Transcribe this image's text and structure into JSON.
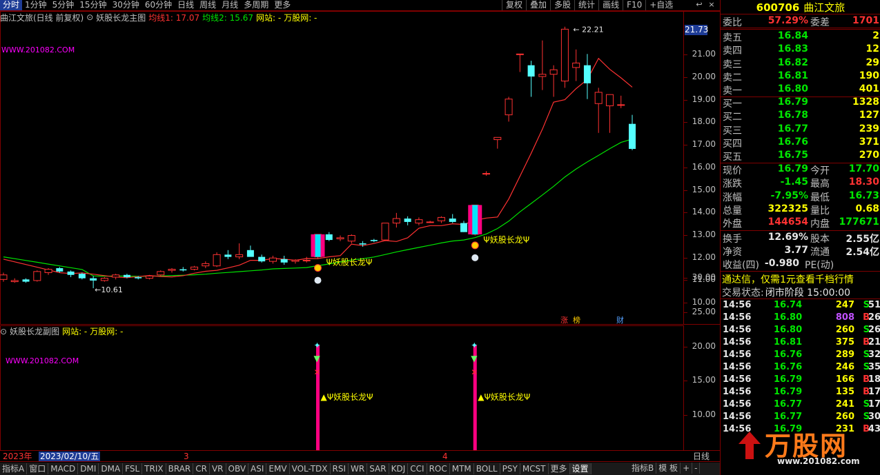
{
  "periods": [
    "分时",
    "1分钟",
    "5分钟",
    "15分钟",
    "30分钟",
    "60分钟",
    "日线",
    "周线",
    "月线",
    "多周期",
    "更多"
  ],
  "active_period": "分时",
  "tools": [
    "复权",
    "叠加",
    "多股",
    "统计",
    "画线",
    "F10",
    "+自选"
  ],
  "win": {
    "back": "↩",
    "close": "×"
  },
  "main": {
    "title": "曲江文旅(日线 前复权)",
    "indicator": "妖股长龙主图",
    "ma1_label": "均线1: 17.07",
    "ma2_label": "均线2: 15.67",
    "site_label": "网站: -",
    "wan_label": "万股网: -",
    "site_url": "WWW.201082.COM",
    "high_label": "22.21",
    "low_label": "←10.61",
    "signal_text": "Ψ妖股长龙Ψ",
    "current_price_tag": "21.73",
    "zhang_tag": "涨",
    "bang_tag": "榜",
    "cai_tag": "财"
  },
  "yaxis_main": [
    "21.00",
    "20.00",
    "19.00",
    "18.00",
    "17.00",
    "16.00",
    "15.00",
    "14.00",
    "13.00",
    "12.00",
    "11.00",
    "10.00"
  ],
  "sub": {
    "indicator": "妖股长龙副图",
    "site_label": "网站: -",
    "wan_label": "万股网: -",
    "site_url": "WWW.201082.COM",
    "signal_text": "▲Ψ妖股长龙Ψ"
  },
  "yaxis_sub": [
    "30.00",
    "25.00",
    "20.00",
    "15.00",
    "10.00"
  ],
  "datebar": {
    "year": "2023年",
    "date": "2023/02/10/五",
    "m3": "3",
    "m4": "4",
    "mode": "日线"
  },
  "tabs": [
    "指标A",
    "窗口",
    "MACD",
    "DMI",
    "DMA",
    "FSL",
    "TRIX",
    "BRAR",
    "CR",
    "VR",
    "OBV",
    "ASI",
    "EMV",
    "VOL-TDX",
    "RSI",
    "WR",
    "SAR",
    "KDJ",
    "CCI",
    "ROC",
    "MTM",
    "BOLL",
    "PSY",
    "MCST",
    "更多",
    "设置"
  ],
  "tabs_right": [
    "指标B",
    "模 板",
    "+",
    "-"
  ],
  "quote": {
    "code": "600706",
    "name": "曲江文旅",
    "weibi_label": "委比",
    "weibi": "57.29%",
    "weicha_label": "委差",
    "weicha": "1701",
    "asks": [
      {
        "label": "卖五",
        "price": "16.84",
        "vol": "2"
      },
      {
        "label": "卖四",
        "price": "16.83",
        "vol": "12"
      },
      {
        "label": "卖三",
        "price": "16.82",
        "vol": "29"
      },
      {
        "label": "卖二",
        "price": "16.81",
        "vol": "190"
      },
      {
        "label": "卖一",
        "price": "16.80",
        "vol": "401"
      }
    ],
    "bids": [
      {
        "label": "买一",
        "price": "16.79",
        "vol": "1328"
      },
      {
        "label": "买二",
        "price": "16.78",
        "vol": "127"
      },
      {
        "label": "买三",
        "price": "16.77",
        "vol": "239"
      },
      {
        "label": "买四",
        "price": "16.76",
        "vol": "371"
      },
      {
        "label": "买五",
        "price": "16.75",
        "vol": "270"
      }
    ],
    "stats": [
      {
        "l1": "现价",
        "v1": "16.79",
        "c1": "dn",
        "l2": "今开",
        "v2": "17.70",
        "c2": "dn"
      },
      {
        "l1": "涨跌",
        "v1": "-1.45",
        "c1": "dn",
        "l2": "最高",
        "v2": "18.30",
        "c2": "up"
      },
      {
        "l1": "涨幅",
        "v1": "-7.95%",
        "c1": "dn",
        "l2": "最低",
        "v2": "16.73",
        "c2": "dn"
      },
      {
        "l1": "总量",
        "v1": "322325",
        "c1": "yl",
        "l2": "量比",
        "v2": "0.68",
        "c2": "yl"
      },
      {
        "l1": "外盘",
        "v1": "144654",
        "c1": "up",
        "l2": "内盘",
        "v2": "177671",
        "c2": "dn"
      },
      {
        "l1": "换手",
        "v1": "12.69%",
        "c1": "wt",
        "l2": "股本",
        "v2": "2.55亿",
        "c2": "wt"
      },
      {
        "l1": "净资",
        "v1": "3.77",
        "c1": "wt",
        "l2": "流通",
        "v2": "2.54亿",
        "c2": "wt"
      },
      {
        "l1": "收益(四)",
        "v1": "-0.980",
        "c1": "wt",
        "l2": "PE(动)",
        "v2": "",
        "c2": "wt"
      }
    ],
    "ad": "通达信，仅需1元查看千档行情",
    "status_label": "交易状态:",
    "status": "闭市阶段 15:00:00",
    "ticks": [
      {
        "t": "14:56",
        "p": "16.74",
        "pc": "dn",
        "q": "247",
        "qc": "yl",
        "s": "S",
        "sc": "dn",
        "n": "51"
      },
      {
        "t": "14:56",
        "p": "16.80",
        "pc": "dn",
        "q": "808",
        "qc": "pu",
        "s": "B",
        "sc": "up",
        "n": "26"
      },
      {
        "t": "14:56",
        "p": "16.80",
        "pc": "dn",
        "q": "260",
        "qc": "yl",
        "s": "S",
        "sc": "dn",
        "n": "26"
      },
      {
        "t": "14:56",
        "p": "16.81",
        "pc": "dn",
        "q": "375",
        "qc": "yl",
        "s": "B",
        "sc": "up",
        "n": "21"
      },
      {
        "t": "14:56",
        "p": "16.76",
        "pc": "dn",
        "q": "289",
        "qc": "yl",
        "s": "S",
        "sc": "dn",
        "n": "32"
      },
      {
        "t": "14:56",
        "p": "16.76",
        "pc": "dn",
        "q": "246",
        "qc": "yl",
        "s": "S",
        "sc": "dn",
        "n": "35"
      },
      {
        "t": "14:56",
        "p": "16.79",
        "pc": "dn",
        "q": "166",
        "qc": "yl",
        "s": "B",
        "sc": "up",
        "n": "18"
      },
      {
        "t": "14:56",
        "p": "16.79",
        "pc": "dn",
        "q": "135",
        "qc": "yl",
        "s": "B",
        "sc": "up",
        "n": "17"
      },
      {
        "t": "14:56",
        "p": "16.77",
        "pc": "dn",
        "q": "241",
        "qc": "yl",
        "s": "S",
        "sc": "dn",
        "n": "17"
      },
      {
        "t": "14:56",
        "p": "16.77",
        "pc": "dn",
        "q": "260",
        "qc": "yl",
        "s": "S",
        "sc": "dn",
        "n": "30"
      },
      {
        "t": "14:56",
        "p": "16.79",
        "pc": "dn",
        "q": "231",
        "qc": "yl",
        "s": "B",
        "sc": "up",
        "n": "43"
      }
    ],
    "watermark": "万股网",
    "watermark_url": "www.201082.com"
  }
}
